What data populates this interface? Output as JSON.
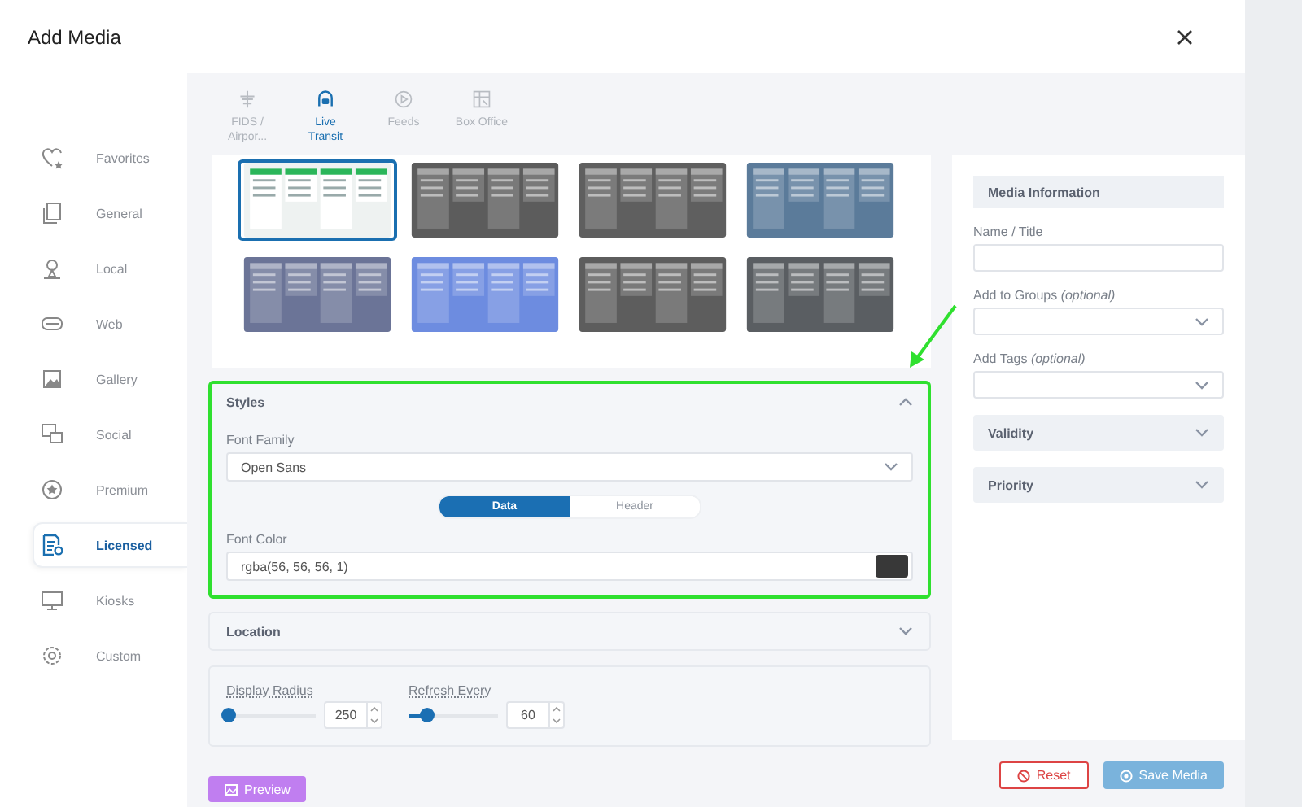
{
  "window": {
    "title": "Add Media"
  },
  "sidebar": {
    "items": [
      {
        "label": "Favorites",
        "selected": false
      },
      {
        "label": "General",
        "selected": false
      },
      {
        "label": "Local",
        "selected": false
      },
      {
        "label": "Web",
        "selected": false
      },
      {
        "label": "Gallery",
        "selected": false
      },
      {
        "label": "Social",
        "selected": false
      },
      {
        "label": "Premium",
        "selected": false
      },
      {
        "label": "Licensed",
        "selected": true
      },
      {
        "label": "Kiosks",
        "selected": false
      },
      {
        "label": "Custom",
        "selected": false
      }
    ]
  },
  "source_tabs": [
    {
      "label": "FIDS / Airpor...",
      "selected": false
    },
    {
      "label": "Live Transit",
      "selected": true
    },
    {
      "label": "Feeds",
      "selected": false
    },
    {
      "label": "Box Office",
      "selected": false
    }
  ],
  "templates": [
    {
      "color": "#eef2f1",
      "selected": true
    },
    {
      "color": "#5c5c5c",
      "selected": false
    },
    {
      "color": "#5f5f5f",
      "selected": false
    },
    {
      "color": "#5b7b9a",
      "selected": false
    },
    {
      "color": "#6b7497",
      "selected": false
    },
    {
      "color": "#6d8ce0",
      "selected": false
    },
    {
      "color": "#5d5d5d",
      "selected": false
    },
    {
      "color": "#5a5e62",
      "selected": false
    }
  ],
  "styles": {
    "title": "Styles",
    "expanded": true,
    "highlighted": true,
    "font_family": {
      "label": "Font Family",
      "value": "Open Sans"
    },
    "toggle": [
      {
        "label": "Data",
        "selected": true
      },
      {
        "label": "Header",
        "selected": false
      }
    ],
    "font_color": {
      "label": "Font Color",
      "value": "rgba(56, 56, 56, 1)"
    }
  },
  "location": {
    "title": "Location",
    "expanded": false
  },
  "sliders": [
    {
      "label": "Display Radius",
      "level": 0.02,
      "value": "250"
    },
    {
      "label": "Refresh Every",
      "level": 0.2,
      "value": "60"
    }
  ],
  "preview_button": "Preview",
  "media_information": {
    "title": "Media Information",
    "fields": [
      {
        "kind": "text",
        "label": "Name / Title"
      },
      {
        "kind": "select",
        "label": "Add to Groups *(optional)*"
      },
      {
        "kind": "select",
        "label": "Add Tags *(optional)*"
      }
    ],
    "sections": [
      {
        "title": "Validity",
        "expanded": false
      },
      {
        "title": "Priority",
        "expanded": false
      }
    ]
  },
  "buttons": {
    "reset": {
      "label": "Reset",
      "disabled": false
    },
    "save": {
      "label": "Save Media",
      "disabled": true
    }
  }
}
